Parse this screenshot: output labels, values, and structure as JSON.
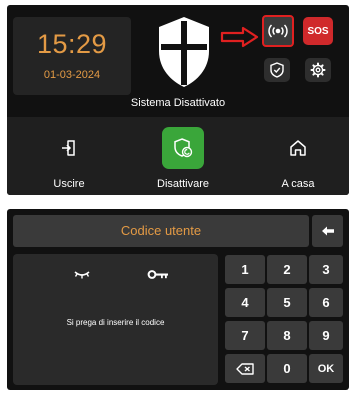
{
  "status_screen": {
    "time": "15:29",
    "date": "01-03-2024",
    "status_text": "Sistema Disattivato",
    "sos_label": "SOS",
    "actions": [
      {
        "label": "Uscire",
        "icon": "exit-door-icon",
        "color": "#3b3b3b"
      },
      {
        "label": "Disattivare",
        "icon": "shield-disarm-icon",
        "color": "#3aa63a"
      },
      {
        "label": "A casa",
        "icon": "home-icon",
        "color": "#3b3b3b"
      }
    ]
  },
  "keypad_screen": {
    "title": "Codice utente",
    "prompt": "Si prega di inserire il codice",
    "keys": [
      "1",
      "2",
      "3",
      "4",
      "5",
      "6",
      "7",
      "8",
      "9",
      "",
      "0",
      "OK"
    ]
  },
  "colors": {
    "accent": "#e39a45",
    "sos": "#d0292b",
    "active_green": "#3aa63a",
    "highlight": "#e02020"
  },
  "icons": [
    "shield-logo-icon",
    "arrow-right-icon",
    "alarm-signal-icon",
    "shield-check-icon",
    "gear-icon",
    "eye-closed-icon",
    "key-icon",
    "arrow-left-icon",
    "backspace-icon"
  ]
}
